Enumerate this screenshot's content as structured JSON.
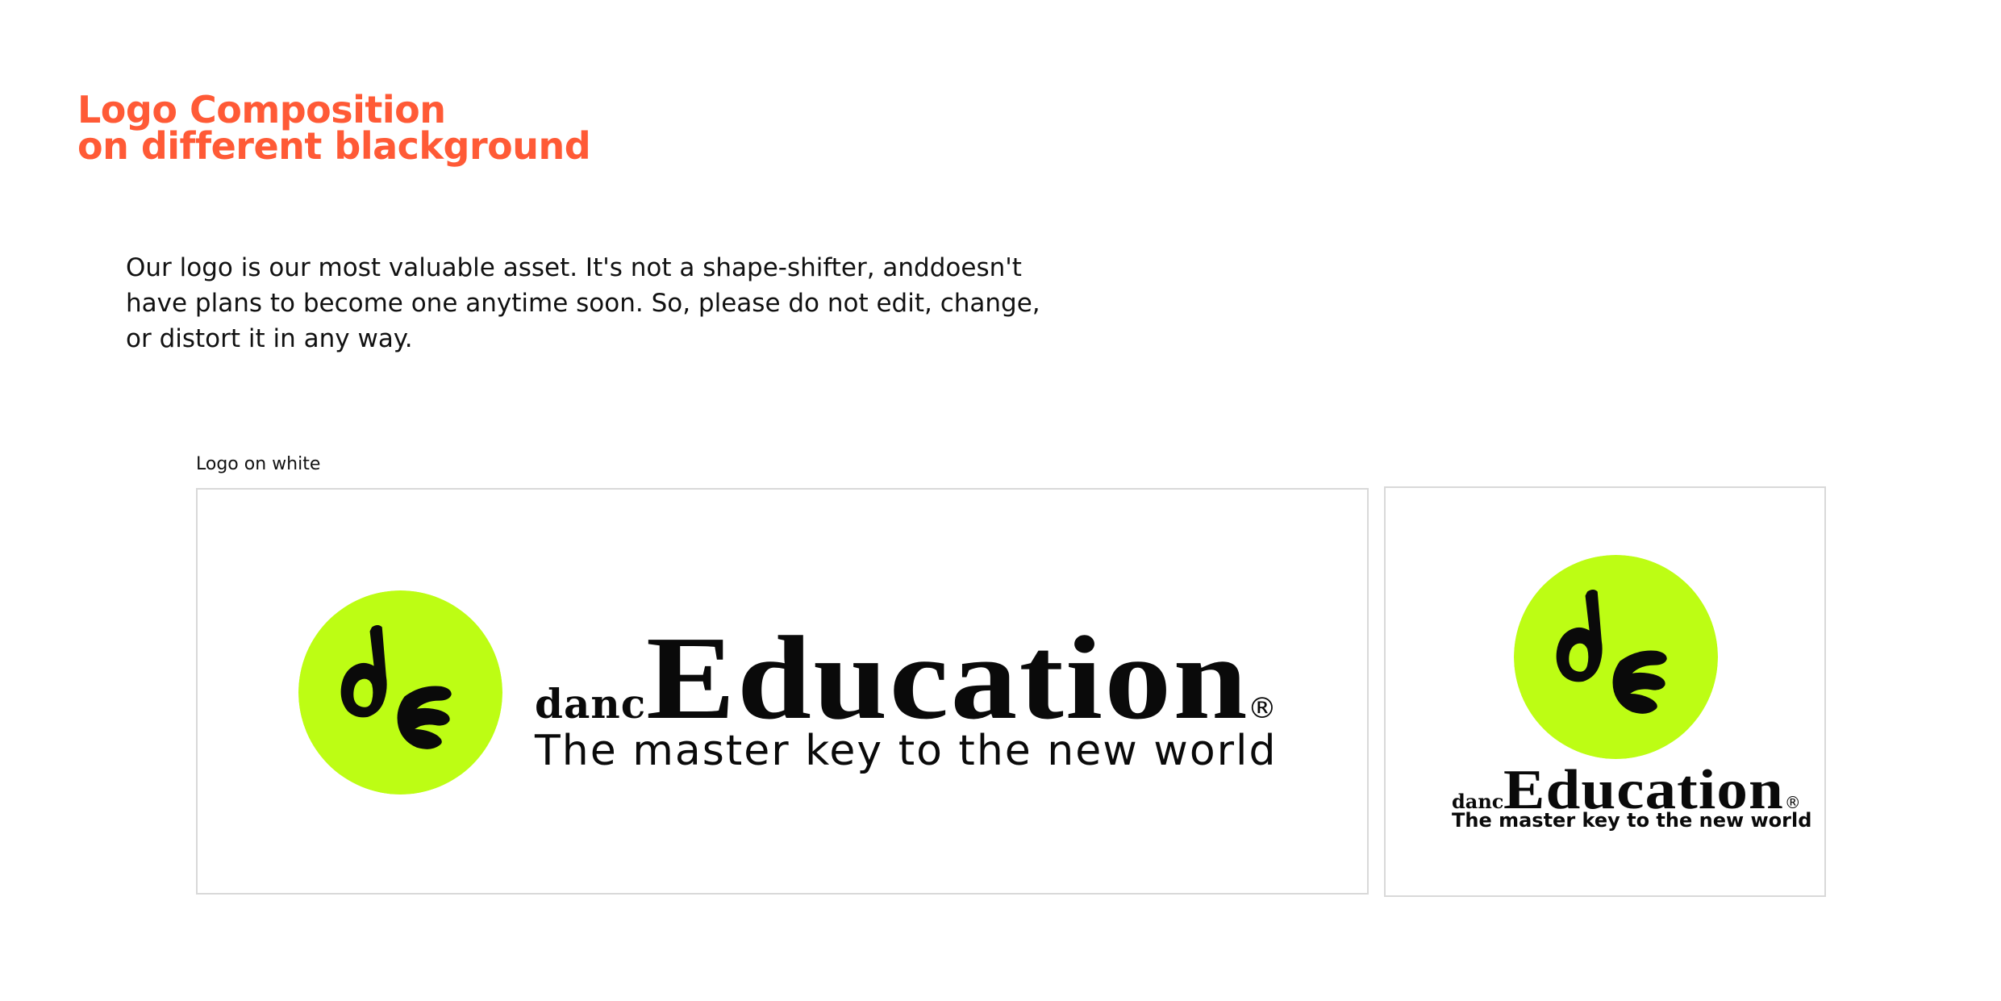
{
  "page": {
    "title_line1": "Logo Composition",
    "title_line2": "on different blackground",
    "description_line1": "Our logo is our most valuable asset. It's not a shape-shifter, anddoesn't",
    "description_line2": "have plans to become one anytime soon. So, please do not edit, change,",
    "description_line3": "or distort it in any way.",
    "section_label": "Logo on white"
  },
  "logo": {
    "wordmark_prefix": "danc",
    "wordmark_main": "Education",
    "registered_mark": "®",
    "tagline": "The master key to the new world",
    "badge_icon": "de-monogram-icon",
    "badge_color": "#bdfd14",
    "ink_color": "#0a0a0a"
  },
  "colors": {
    "accent": "#ff5a36",
    "card_border": "#d9d9d9",
    "background": "#ffffff"
  }
}
